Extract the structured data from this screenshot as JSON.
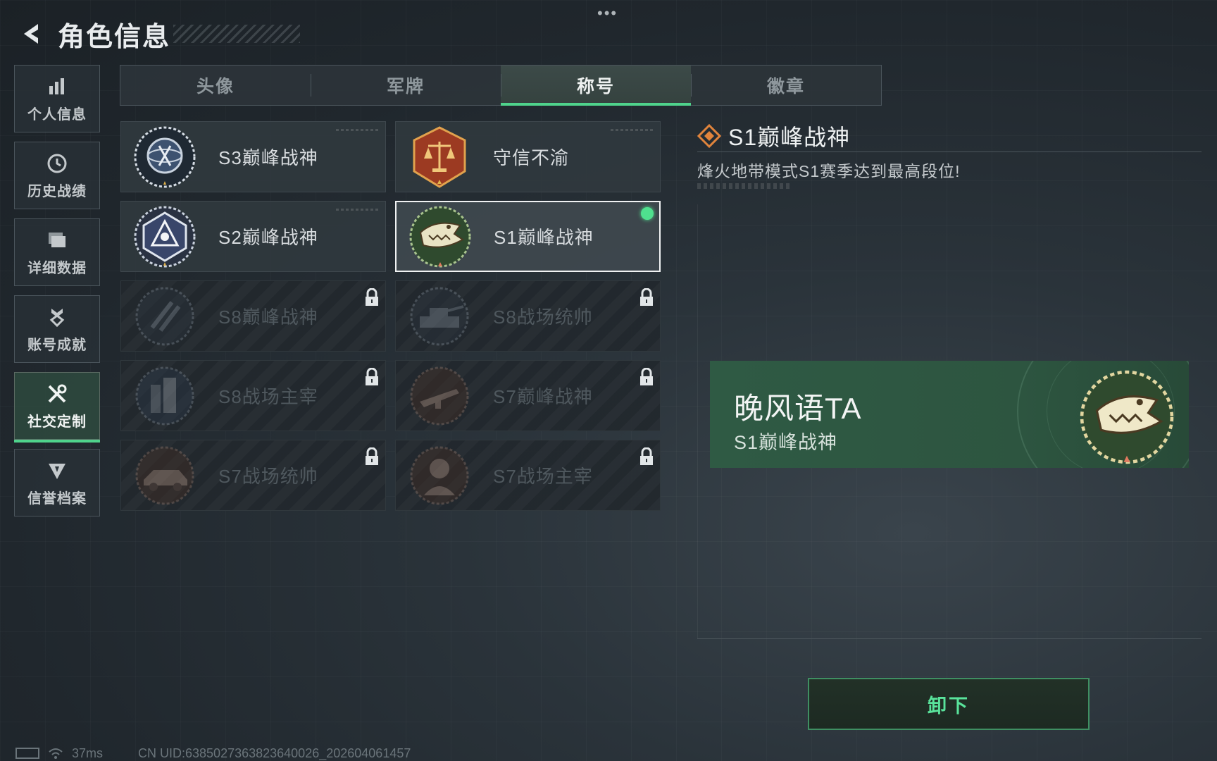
{
  "header": {
    "title": "角色信息"
  },
  "sidebar": {
    "items": [
      {
        "label": "个人信息",
        "icon": "bar-chart-icon"
      },
      {
        "label": "历史战绩",
        "icon": "history-icon"
      },
      {
        "label": "详细数据",
        "icon": "folder-icon"
      },
      {
        "label": "账号成就",
        "icon": "achievement-icon"
      },
      {
        "label": "社交定制",
        "icon": "tools-icon",
        "active": true
      },
      {
        "label": "信誉档案",
        "icon": "credit-icon"
      }
    ]
  },
  "tabs": [
    {
      "label": "头像"
    },
    {
      "label": "军牌"
    },
    {
      "label": "称号",
      "active": true
    },
    {
      "label": "徽章"
    }
  ],
  "titles": [
    {
      "name": "S3巅峰战神",
      "emblem": "globe-emblem",
      "locked": false
    },
    {
      "name": "守信不渝",
      "emblem": "scales-emblem",
      "locked": false
    },
    {
      "name": "S2巅峰战神",
      "emblem": "triangle-emblem",
      "locked": false
    },
    {
      "name": "S1巅峰战神",
      "emblem": "crocodile-emblem",
      "locked": false,
      "selected": true,
      "equipped": true
    },
    {
      "name": "S8巅峰战神",
      "emblem": "slash-emblem",
      "locked": true
    },
    {
      "name": "S8战场统帅",
      "emblem": "tank-emblem",
      "locked": true
    },
    {
      "name": "S8战场主宰",
      "emblem": "city-emblem",
      "locked": true
    },
    {
      "name": "S7巅峰战神",
      "emblem": "rifle-emblem",
      "locked": true
    },
    {
      "name": "S7战场统帅",
      "emblem": "vehicle-emblem",
      "locked": true
    },
    {
      "name": "S7战场主宰",
      "emblem": "soldier-emblem",
      "locked": true
    }
  ],
  "detail": {
    "title": "S1巅峰战神",
    "description": "烽火地带模式S1赛季达到最高段位!"
  },
  "preview": {
    "player_name": "晚风语TA",
    "title": "S1巅峰战神"
  },
  "actions": {
    "unequip_label": "卸下"
  },
  "status_bar": {
    "ping": "37ms",
    "uid": "CN UID:6385027363823640026_202604061457"
  },
  "colors": {
    "accent": "#4fd38c",
    "equipped_dot": "#4fe08e",
    "preview_bg": "#2f5a44"
  }
}
